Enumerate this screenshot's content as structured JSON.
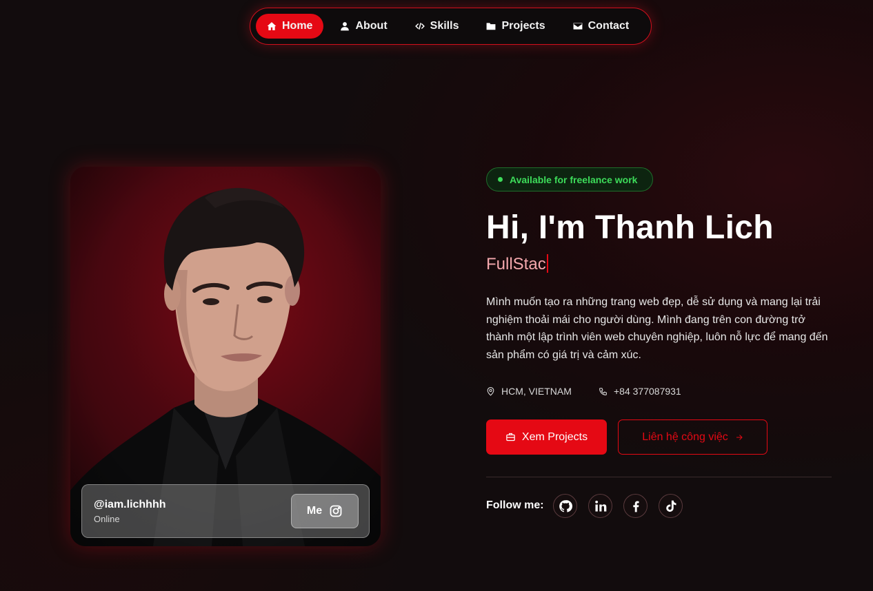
{
  "nav": {
    "items": [
      {
        "label": "Home",
        "icon": "home-icon",
        "active": true
      },
      {
        "label": "About",
        "icon": "user-icon",
        "active": false
      },
      {
        "label": "Skills",
        "icon": "code-icon",
        "active": false
      },
      {
        "label": "Projects",
        "icon": "folder-icon",
        "active": false
      },
      {
        "label": "Contact",
        "icon": "envelope-icon",
        "active": false
      }
    ]
  },
  "profile_card": {
    "handle": "@iam.lichhhh",
    "status": "Online",
    "button_label": "Me",
    "button_icon": "instagram-icon"
  },
  "hero": {
    "badge": "Available for freelance work",
    "title": "Hi, I'm Thanh Lich",
    "typed_text": "FullStac",
    "bio": "Mình muốn tạo ra những trang web đẹp, dễ sử dụng và mang lại trải nghiệm thoải mái cho người dùng. Mình đang trên con đường trở thành một lập trình viên web chuyên nghiệp, luôn nỗ lực để mang đến sản phẩm có giá trị và cảm xúc.",
    "location": "HCM, VIETNAM",
    "phone": "+84 377087931",
    "primary_button": "Xem Projects",
    "secondary_button": "Liên hệ công việc",
    "follow_label": "Follow me:",
    "socials": [
      "github-icon",
      "linkedin-icon",
      "facebook-icon",
      "tiktok-icon"
    ]
  },
  "colors": {
    "accent": "#e50914",
    "available_green": "#3ddc5a",
    "background": "#120c0d"
  }
}
